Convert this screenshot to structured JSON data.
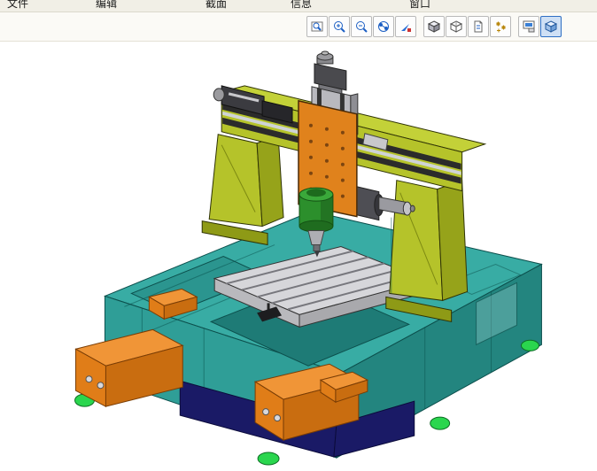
{
  "menu": {
    "items": [
      {
        "label": "文件"
      },
      {
        "label": "编辑"
      },
      {
        "label": "截面"
      },
      {
        "label": "信息"
      },
      {
        "label": "窗口"
      }
    ]
  },
  "toolbar": {
    "buttons": [
      {
        "id": "zoom-window",
        "icon": "zoom-window-icon",
        "active": false
      },
      {
        "id": "zoom-in",
        "icon": "zoom-in-icon",
        "active": false
      },
      {
        "id": "zoom-out",
        "icon": "zoom-out-icon",
        "active": false
      },
      {
        "id": "rotate-view",
        "icon": "rotate-view-icon",
        "active": false
      },
      {
        "id": "dynamic-view",
        "icon": "dynamic-view-icon",
        "active": false
      },
      {
        "id": "isometric-view",
        "icon": "isometric-view-icon",
        "active": false
      },
      {
        "id": "wireframe-view",
        "icon": "wireframe-view-icon",
        "active": false
      },
      {
        "id": "drawing-sheet",
        "icon": "drawing-sheet-icon",
        "active": false
      },
      {
        "id": "regenerate",
        "icon": "regenerate-icon",
        "active": false
      },
      {
        "id": "display-mode",
        "icon": "display-mode-icon",
        "active": false
      },
      {
        "id": "shaded-view",
        "icon": "shaded-view-icon",
        "active": true
      }
    ]
  },
  "viewport": {
    "model_subject": "CNC gantry milling machine 3D assembly",
    "model_parts": [
      "machine-base",
      "chip-drawer-left",
      "chip-drawer-front",
      "worktable-t-slots",
      "gantry-column-left",
      "gantry-column-right",
      "cross-beam-linear-rails",
      "saddle-plate",
      "z-axis-tower",
      "z-motor",
      "spindle-motor",
      "y-axis-motor",
      "leveling-feet",
      "cabinet-panel"
    ]
  },
  "colors": {
    "base_teal": "#2f9e97",
    "base_teal_light": "#38aca4",
    "base_teal_dark": "#23857f",
    "gantry_yellow": "#b5c32a",
    "gantry_yellow_dark": "#96a31a",
    "plate_orange": "#e0821c",
    "drawer_orange": "#e8871f",
    "spindle_green": "#2c8f2c",
    "table_gray": "#d6d6da",
    "cabinet_navy": "#1a1a66",
    "foot_green": "#2ad64e",
    "toolbar_active_bg": "#cfe0f5",
    "toolbar_active_border": "#2f6fc4"
  }
}
